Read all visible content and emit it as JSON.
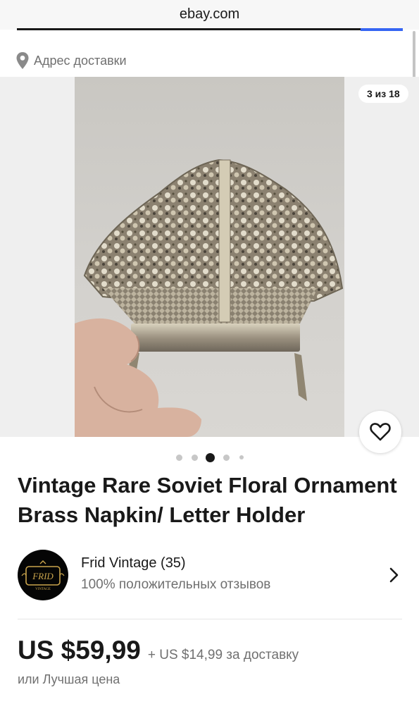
{
  "browser": {
    "url": "ebay.com"
  },
  "delivery": {
    "label": "Адрес доставки",
    "icon": "location-pin-icon"
  },
  "gallery": {
    "counter": "3 из 18",
    "total_images": 18,
    "current_image": 3,
    "favorite_icon": "heart-icon"
  },
  "listing": {
    "title": "Vintage Rare Soviet Floral Ornament Brass Napkin/ Letter Holder"
  },
  "seller": {
    "name": "Frid Vintage (35)",
    "feedback": "100% положительных отзывов",
    "logo_text": "FRID",
    "logo_subtext": "VINTAGE"
  },
  "pricing": {
    "price": "US $59,99",
    "shipping": "+ US $14,99 за доставку",
    "best_offer": "или Лучшая цена"
  },
  "colors": {
    "accent_blue": "#3665f3",
    "text_primary": "#191919",
    "text_secondary": "#707070",
    "gallery_bg": "#efefef",
    "logo_gold": "#c9a44c"
  }
}
